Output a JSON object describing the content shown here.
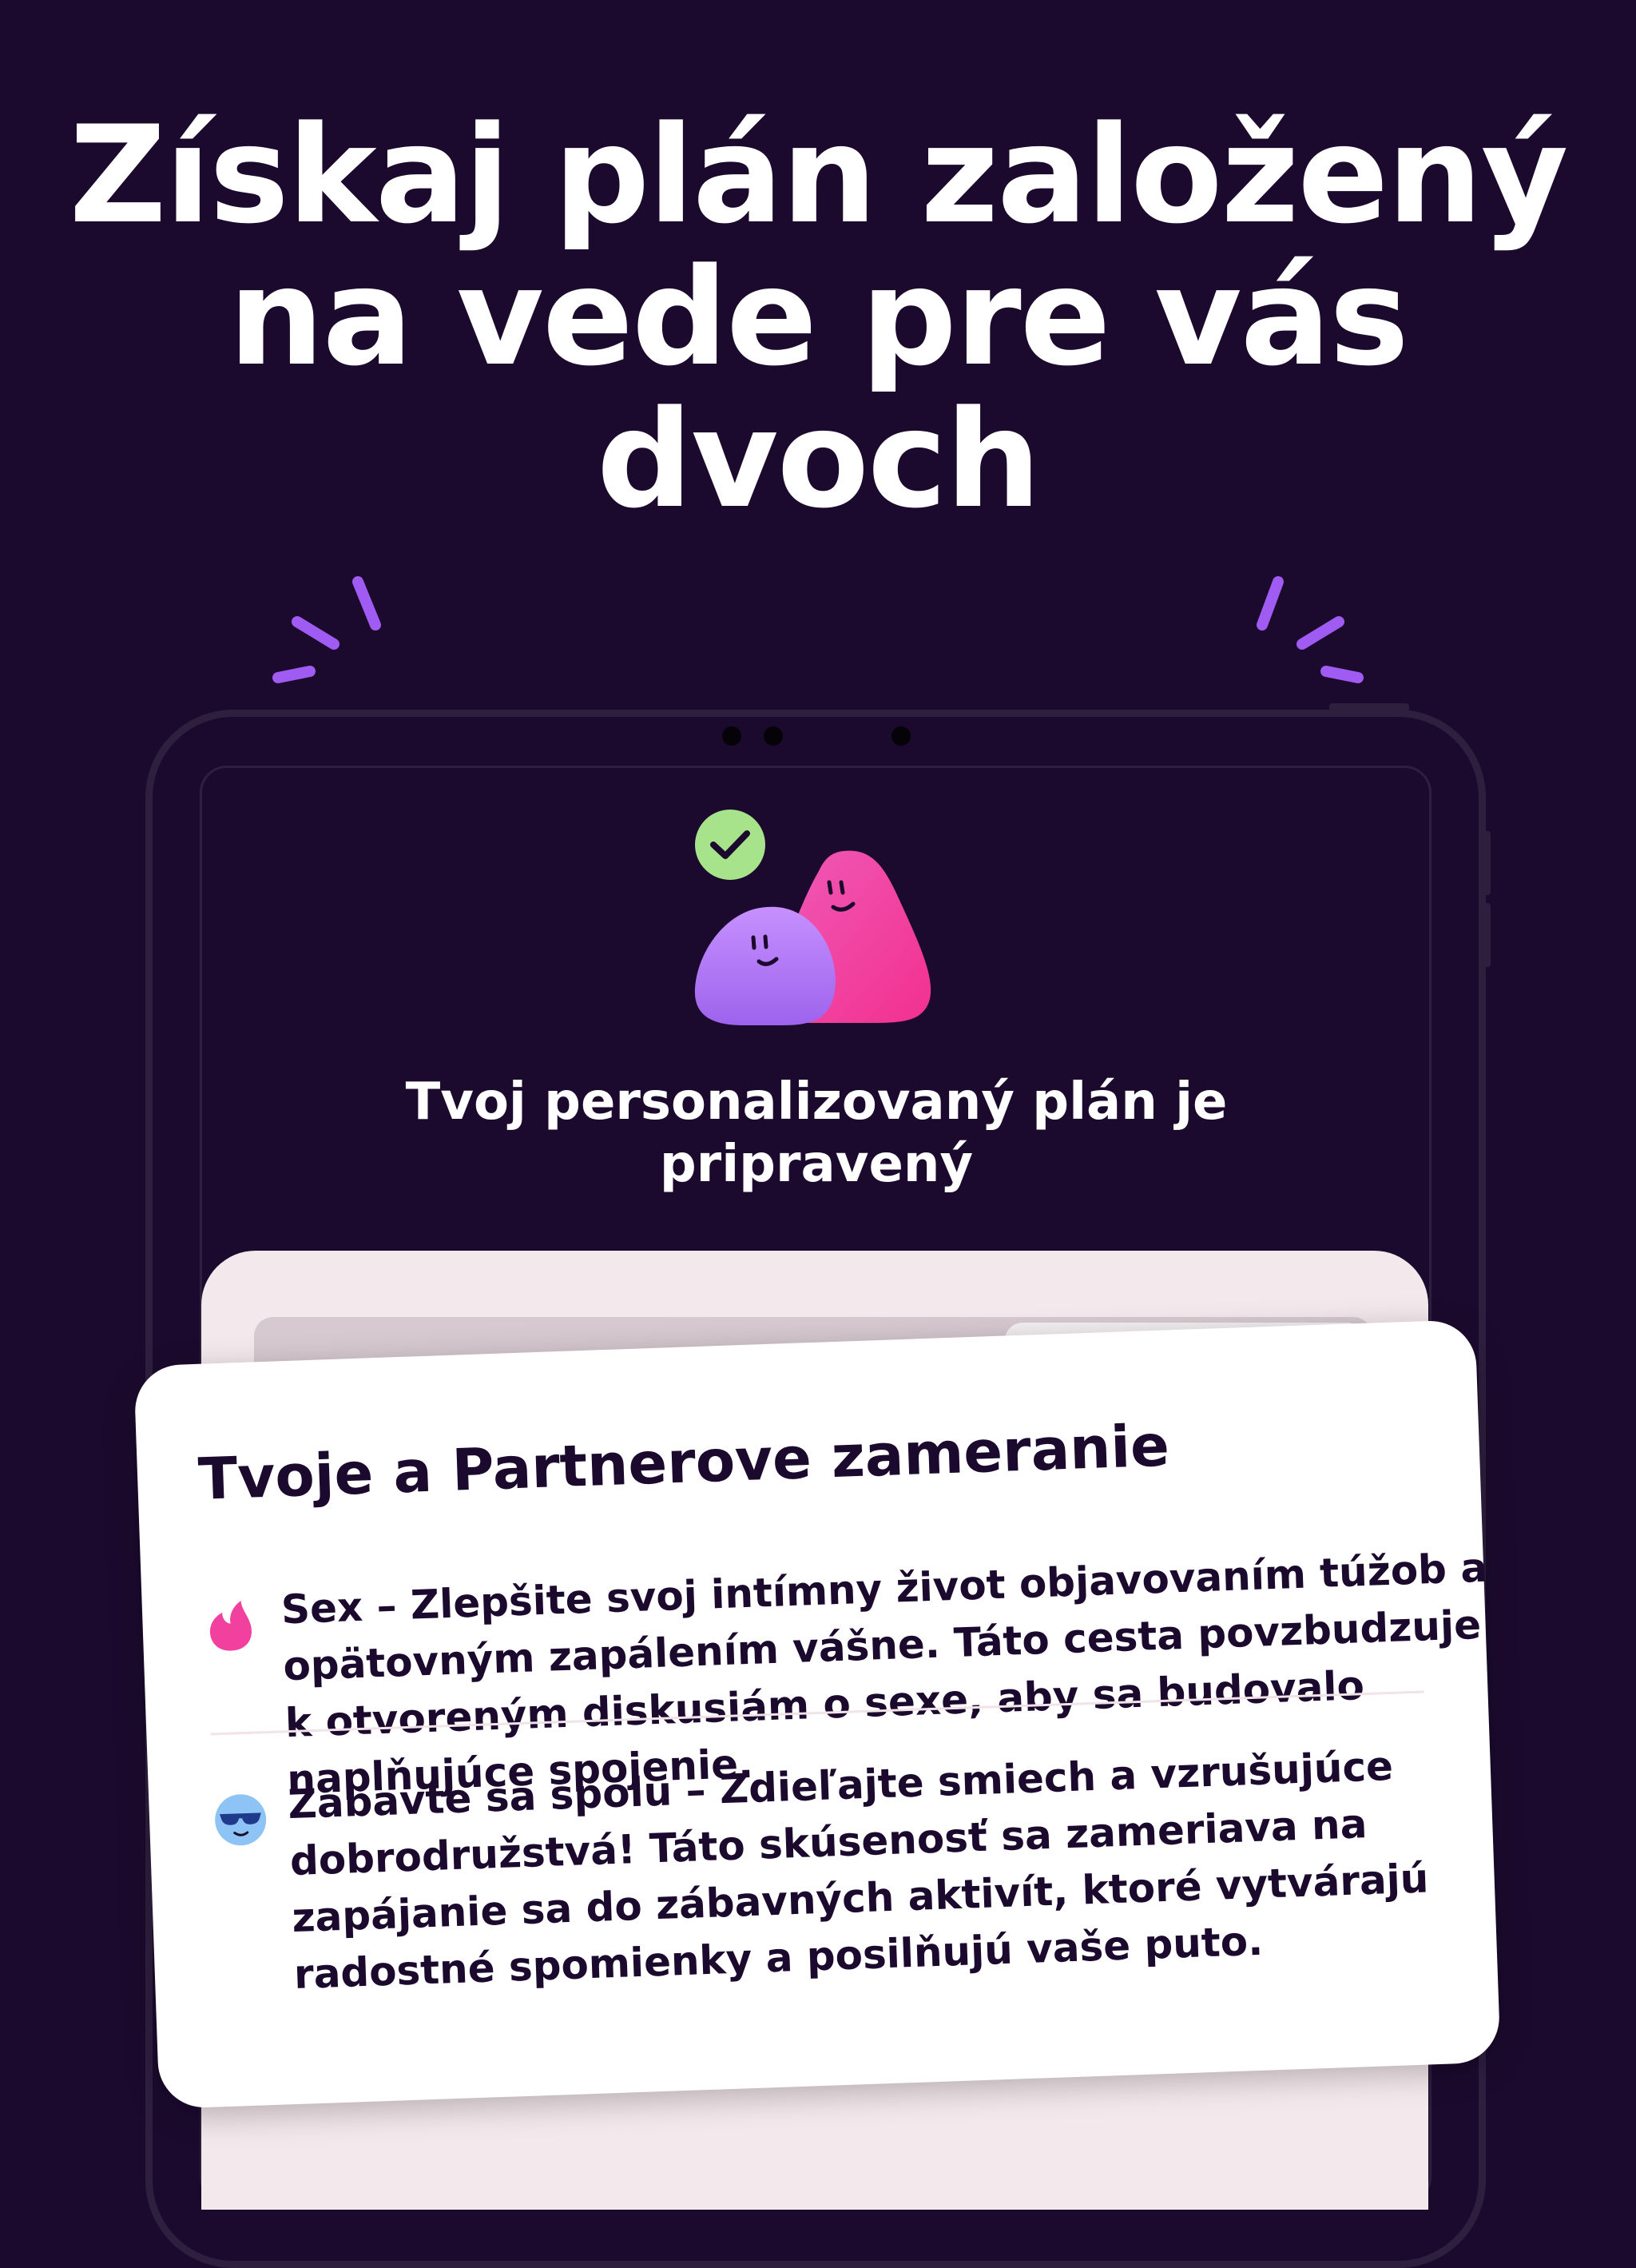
{
  "headline": {
    "lines": [
      "Získaj plán založený",
      "na vede pre vás",
      "dvoch"
    ]
  },
  "screen": {
    "title_lines": [
      "Tvoj personalizovaný plán je",
      "pripravený"
    ]
  },
  "card": {
    "title": "Tvoje a Partnerove zameranie",
    "items": [
      {
        "icon": "flame-icon",
        "lines": [
          "Sex – Zlepšite svoj intímny život objavovaním túžob a",
          "opätovným zapálením vášne. Táto cesta povzbudzuje",
          "k otvoreným diskusiám o sexe, aby sa budovalo",
          "naplňujúce spojenie."
        ]
      },
      {
        "icon": "sunglasses-face-icon",
        "lines": [
          "Zabavte sa spolu – Zdieľajte smiech a vzrušujúce",
          "dobrodružstvá! Táto skúsenosť sa zameriava na",
          "zapájanie sa do zábavných aktivít, ktoré vytvárajú",
          "radostné spomienky a posilňujú vaše puto."
        ]
      }
    ]
  },
  "colors": {
    "background": "#1c0a2e",
    "accent_purple": "#a259f7",
    "accent_pink": "#f2409f",
    "check_green": "#a7e38a",
    "panel_pink": "#f3e8ec"
  }
}
